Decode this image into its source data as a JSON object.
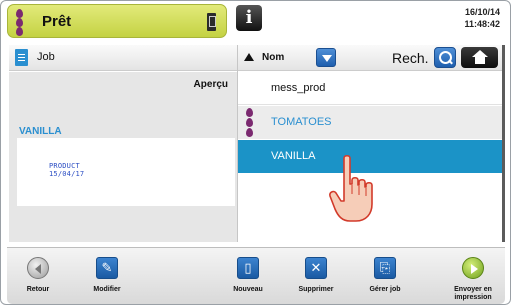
{
  "status_bar": {
    "title": "Prêt",
    "date": "16/10/14",
    "time": "11:48:42",
    "info_icon": "info-icon",
    "usb_icon": "usb-icon"
  },
  "left_panel": {
    "header_label": "Job",
    "preview_label": "Aperçu",
    "selected_job_name": "VANILLA",
    "preview_line1": "PRODUCT",
    "preview_line2": "15/04/17"
  },
  "right_panel": {
    "sort_label": "Nom",
    "search_label": "Rech.",
    "items": [
      {
        "label": "mess_prod",
        "state": "normal"
      },
      {
        "label": "TOMATOES",
        "state": "highlighted"
      },
      {
        "label": "VANILLA",
        "state": "selected"
      }
    ]
  },
  "toolbar": {
    "buttons": [
      {
        "label": "Retour",
        "icon": "back-icon"
      },
      {
        "label": "Modifier",
        "icon": "edit-icon"
      },
      {
        "label": "Nouveau",
        "icon": "new-document-icon"
      },
      {
        "label": "Supprimer",
        "icon": "delete-icon"
      },
      {
        "label": "Gérer job",
        "icon": "manage-job-icon"
      },
      {
        "label": "Envoyer en impression",
        "icon": "send-to-print-icon"
      }
    ]
  },
  "colors": {
    "status_green": "#c4d243",
    "selection_blue": "#1b93c7",
    "accent_blue": "#2a8fd0",
    "ink_purple": "#7b2a70"
  }
}
